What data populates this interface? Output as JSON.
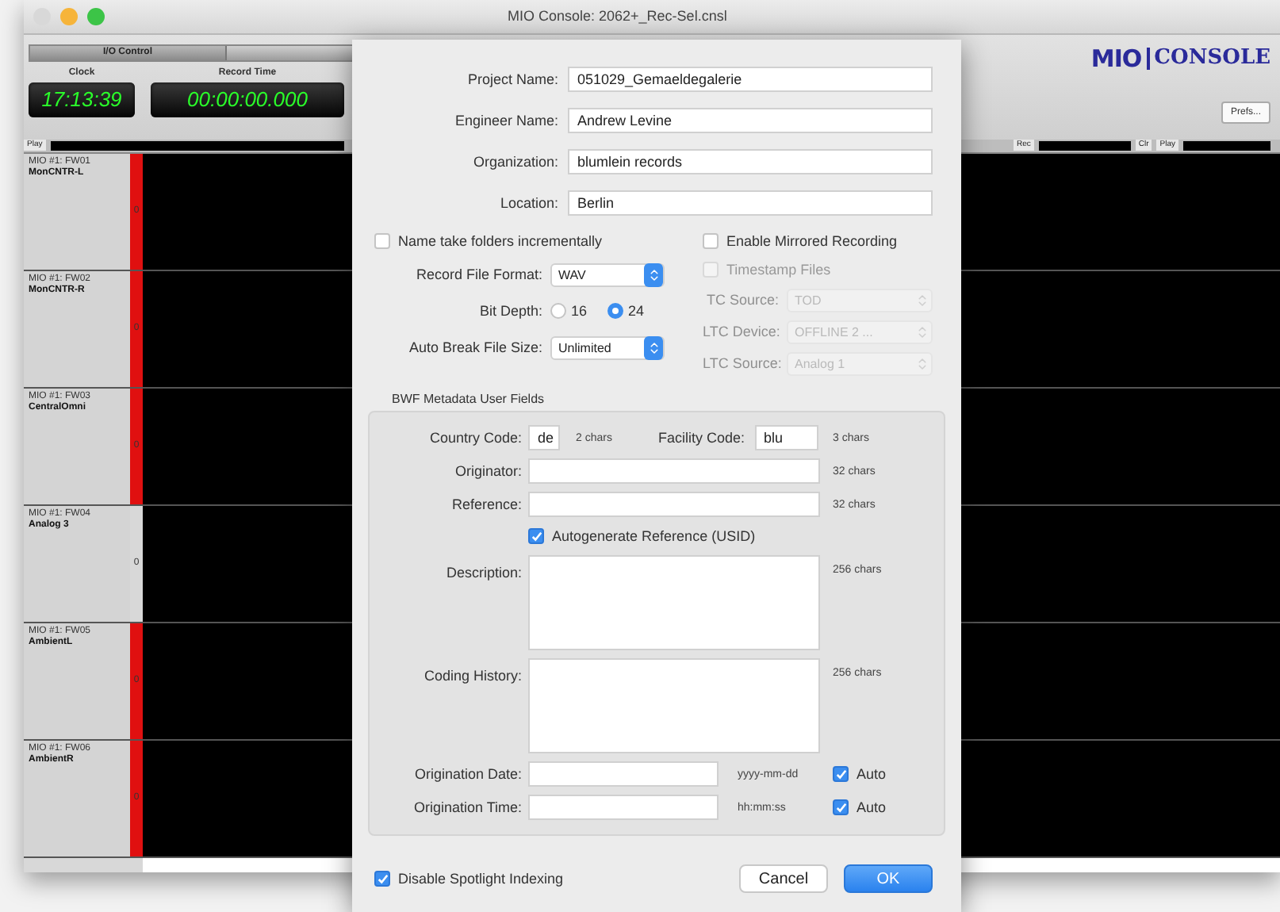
{
  "window": {
    "title": "MIO Console: 2062+_Rec-Sel.cnsl"
  },
  "toolbar": {
    "tabs": [
      {
        "label": "I/O Control",
        "selected": true
      }
    ],
    "clock": {
      "label": "Clock",
      "value": "17:13:39"
    },
    "record_time": {
      "label": "Record Time",
      "value": "00:00:00.000"
    },
    "logo": {
      "left": "MIO",
      "right": "CONSOLE"
    },
    "prefs_button": "Prefs..."
  },
  "strip_header": {
    "left_label": "Play",
    "right_labels": [
      "Rec",
      "Clr",
      "Play"
    ]
  },
  "tracks": [
    {
      "source": "MIO #1: FW01",
      "name": "MonCNTR-L",
      "meter": "0",
      "armed": true
    },
    {
      "source": "MIO #1: FW02",
      "name": "MonCNTR-R",
      "meter": "0",
      "armed": true
    },
    {
      "source": "MIO #1: FW03",
      "name": "CentralOmni",
      "meter": "0",
      "armed": true
    },
    {
      "source": "MIO #1: FW04",
      "name": "Analog 3",
      "meter": "0",
      "armed": false
    },
    {
      "source": "MIO #1: FW05",
      "name": "AmbientL",
      "meter": "0",
      "armed": true
    },
    {
      "source": "MIO #1: FW06",
      "name": "AmbientR",
      "meter": "0",
      "armed": true
    }
  ],
  "dialog": {
    "fields": [
      {
        "label": "Project Name:",
        "value": "051029_Gemaeldegalerie"
      },
      {
        "label": "Engineer Name:",
        "value": "Andrew Levine"
      },
      {
        "label": "Organization:",
        "value": "blumlein records"
      },
      {
        "label": "Location:",
        "value": "Berlin"
      }
    ],
    "name_take_folders": {
      "label": "Name take folders incrementally",
      "checked": false
    },
    "record_file_format": {
      "label": "Record File Format:",
      "value": "WAV"
    },
    "bit_depth": {
      "label": "Bit Depth:",
      "options": [
        {
          "label": "16",
          "selected": false
        },
        {
          "label": "24",
          "selected": true
        }
      ]
    },
    "auto_break": {
      "label": "Auto Break File Size:",
      "value": "Unlimited"
    },
    "mirrored": {
      "label": "Enable Mirrored Recording",
      "checked": false
    },
    "timestamp": {
      "label": "Timestamp Files",
      "checked": false,
      "disabled": true
    },
    "timecode_selects": [
      {
        "label": "TC Source:",
        "value": "TOD",
        "disabled": true
      },
      {
        "label": "LTC Device:",
        "value": "OFFLINE 2 ...",
        "disabled": true
      },
      {
        "label": "LTC Source:",
        "value": "Analog 1",
        "disabled": true
      }
    ],
    "bwf": {
      "title": "BWF Metadata User Fields",
      "country_code": {
        "label": "Country Code:",
        "value": "de",
        "hint": "2 chars"
      },
      "facility_code": {
        "label": "Facility Code:",
        "value": "blu",
        "hint": "3 chars"
      },
      "rows": [
        {
          "kind": "line",
          "label": "Originator:",
          "hint": "32 chars"
        },
        {
          "kind": "line",
          "label": "Reference:",
          "hint": "32 chars"
        },
        {
          "kind": "check",
          "label": "Autogenerate Reference (USID)",
          "checked": true
        },
        {
          "kind": "area",
          "label": "Description:",
          "hint": "256 chars"
        },
        {
          "kind": "area",
          "label": "Coding History:",
          "hint": "256 chars"
        },
        {
          "kind": "dated",
          "label": "Origination Date:",
          "format": "yyyy-mm-dd",
          "auto": {
            "label": "Auto",
            "checked": true
          }
        },
        {
          "kind": "dated",
          "label": "Origination Time:",
          "format": "hh:mm:ss",
          "auto": {
            "label": "Auto",
            "checked": true
          }
        }
      ]
    },
    "spotlight": {
      "label": "Disable Spotlight Indexing",
      "checked": true
    },
    "buttons": [
      {
        "label": "Cancel",
        "default": false
      },
      {
        "label": "OK",
        "default": true
      }
    ]
  }
}
